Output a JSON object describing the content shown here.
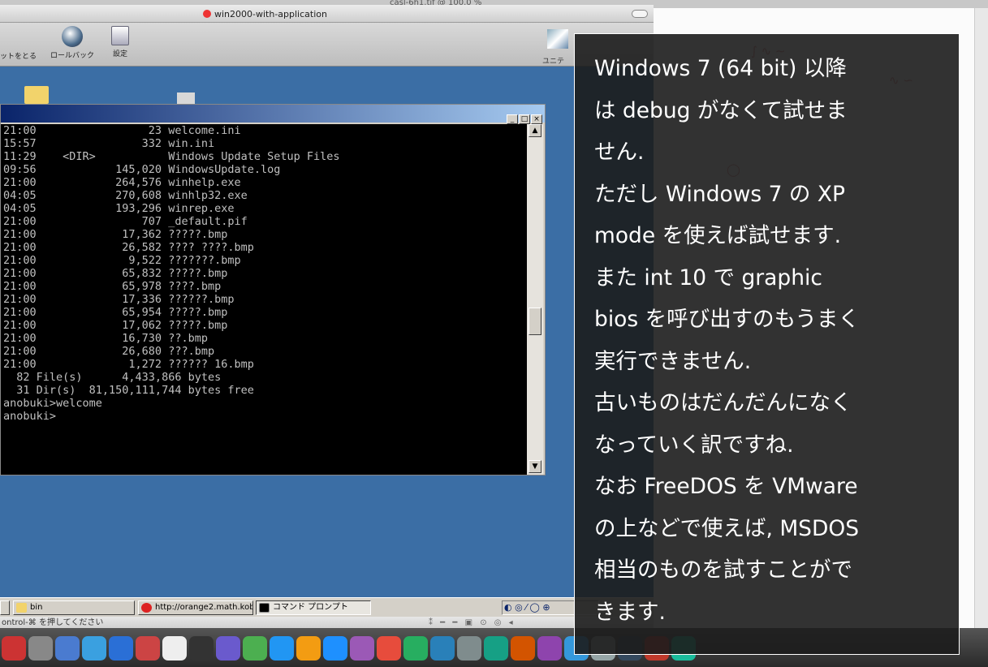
{
  "background_window": {
    "title": "casl-6h1.tif @ 100.0 %"
  },
  "vm": {
    "title": "win2000-with-application",
    "toolbar": [
      {
        "label": "ットをとる"
      },
      {
        "label": "ロールバック"
      },
      {
        "label": "設定"
      }
    ],
    "toolbar_right_label": "ユニテ"
  },
  "cmd": {
    "lines": [
      "21:00                 23 welcome.ini",
      "15:57                332 win.ini",
      "11:29    <DIR>           Windows Update Setup Files",
      "09:56            145,020 WindowsUpdate.log",
      "21:00            264,576 winhelp.exe",
      "04:05            270,608 winhlp32.exe",
      "04:05            193,296 winrep.exe",
      "21:00                707 _default.pif",
      "21:00             17,362 ?????.bmp",
      "21:00             26,582 ???? ????.bmp",
      "21:00              9,522 ???????.bmp",
      "21:00             65,832 ?????.bmp",
      "21:00             65,978 ????.bmp",
      "21:00             17,336 ??????.bmp",
      "21:00             65,954 ?????.bmp",
      "21:00             17,062 ?????.bmp",
      "21:00             16,730 ??.bmp",
      "21:00             26,680 ???.bmp",
      "21:00              1,272 ?????? 16.bmp",
      "  82 File(s)      4,433,866 bytes",
      "  31 Dir(s)  81,150,111,744 bytes free",
      "",
      "anobuki>welcome",
      "",
      "anobuki>"
    ]
  },
  "taskbar": {
    "items": [
      {
        "label": "bin"
      },
      {
        "label": "http://orange2.math.kob..."
      },
      {
        "label": "コマンド プロンプト"
      }
    ]
  },
  "status": {
    "text": "ontrol-⌘ を押してください"
  },
  "caption": {
    "lines": [
      "Windows 7 (64 bit) 以降",
      "は debug がなくて試せま",
      "せん.",
      "ただし Windows 7 の XP",
      "mode を使えば試せます.",
      "また int 10 で graphic",
      "bios を呼び出すのもうまく",
      "実行できません.",
      "古いものはだんだんになく",
      "なっていく訳ですね.",
      "なお FreeDOS を VMware",
      "の上などで使えば, MSDOS",
      "相当のものを試すことがで",
      "きます."
    ]
  },
  "colors": {
    "desktop": "#3b6ea5",
    "titlebar": "#0a246a",
    "caption_bg": "#1c1c1c"
  }
}
